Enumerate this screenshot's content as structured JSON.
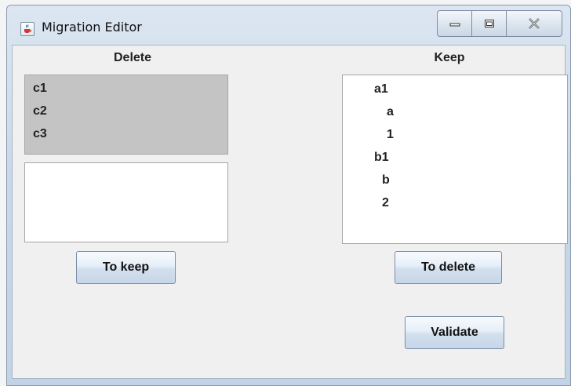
{
  "window": {
    "title": "Migration Editor",
    "icon": "java-cup-icon"
  },
  "delete_panel": {
    "header": "Delete",
    "selected_items": [
      "c1",
      "c2",
      "c3"
    ],
    "secondary_items": [],
    "button_label": "To keep"
  },
  "keep_panel": {
    "header": "Keep",
    "tree": [
      {
        "label": "a1",
        "level": 0
      },
      {
        "label": "a",
        "level": 1
      },
      {
        "label": "1",
        "level": 1
      },
      {
        "label": "b1",
        "level": 0
      },
      {
        "label": "b",
        "level": 1
      },
      {
        "label": "2",
        "level": 1
      }
    ],
    "button_label": "To delete"
  },
  "validate_button": "Validate",
  "colors": {
    "selected_list_bg": "#c4c4c4",
    "list_bg": "#ffffff",
    "window_bg": "#f0f0f0"
  }
}
